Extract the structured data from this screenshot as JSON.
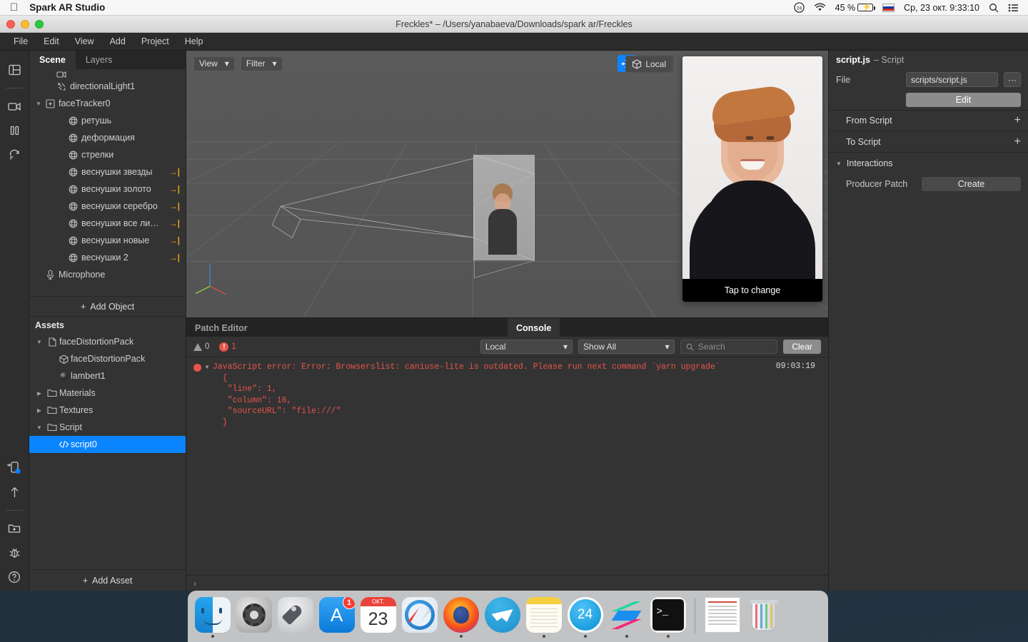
{
  "menubar": {
    "apple_icon": "apple-logo",
    "app_name": "Spark AR Studio",
    "battery_percent": "45 %",
    "datetime": "Ср, 23 окт.  9:33:10",
    "search_icon": "search-icon",
    "list_icon": "control-center-icon",
    "wifi_icon": "wifi-icon",
    "clock24_icon": "24-icon"
  },
  "window": {
    "title": "Freckles* – /Users/yanabaeva/Downloads/spark ar/Freckles",
    "menu": [
      "File",
      "Edit",
      "View",
      "Add",
      "Project",
      "Help"
    ]
  },
  "rail": {
    "items": [
      {
        "name": "layout-icon"
      },
      {
        "name": "camera-icon"
      },
      {
        "name": "pause-icon"
      },
      {
        "name": "refresh-icon"
      }
    ],
    "bottom_items": [
      {
        "name": "send-to-device-icon"
      },
      {
        "name": "upload-icon"
      },
      {
        "name": "new-folder-icon"
      },
      {
        "name": "bug-icon"
      },
      {
        "name": "help-icon"
      }
    ]
  },
  "scene": {
    "tabs": [
      {
        "label": "Scene",
        "active": true
      },
      {
        "label": "Layers",
        "active": false
      }
    ],
    "items": [
      {
        "label": "",
        "icon": "camera-icon",
        "depth": 2,
        "clipped": true,
        "twisty": "",
        "arrow": false
      },
      {
        "label": "directionalLight1",
        "icon": "light-icon",
        "depth": 2,
        "twisty": "",
        "arrow": false
      },
      {
        "label": "faceTracker0",
        "icon": "tracker-icon",
        "depth": 1,
        "twisty": "▼",
        "arrow": false
      },
      {
        "label": "ретушь",
        "icon": "mesh-icon",
        "depth": 3,
        "twisty": "",
        "arrow": false
      },
      {
        "label": "деформация",
        "icon": "mesh-icon",
        "depth": 3,
        "twisty": "",
        "arrow": false
      },
      {
        "label": "стрелки",
        "icon": "mesh-icon",
        "depth": 3,
        "twisty": "",
        "arrow": false
      },
      {
        "label": "веснушки звезды",
        "icon": "mesh-icon",
        "depth": 3,
        "twisty": "",
        "arrow": true
      },
      {
        "label": "веснушки золото",
        "icon": "mesh-icon",
        "depth": 3,
        "twisty": "",
        "arrow": true
      },
      {
        "label": "веснушки серебро",
        "icon": "mesh-icon",
        "depth": 3,
        "twisty": "",
        "arrow": true
      },
      {
        "label": "веснушки все ли…",
        "icon": "mesh-icon",
        "depth": 3,
        "twisty": "",
        "arrow": true
      },
      {
        "label": "веснушки новые",
        "icon": "mesh-icon",
        "depth": 3,
        "twisty": "",
        "arrow": true
      },
      {
        "label": "веснушки 2",
        "icon": "mesh-icon",
        "depth": 3,
        "twisty": "",
        "arrow": true
      },
      {
        "label": "Microphone",
        "icon": "microphone-icon",
        "depth": 1,
        "twisty": "",
        "arrow": false
      }
    ],
    "add_object_label": "Add Object"
  },
  "assets": {
    "header": "Assets",
    "items": [
      {
        "label": "faceDistortionPack",
        "icon": "file-icon",
        "depth": 1,
        "twisty": "▼",
        "selected": false
      },
      {
        "label": "faceDistortionPack",
        "icon": "cube-icon",
        "depth": 2,
        "twisty": "",
        "selected": false
      },
      {
        "label": "lambert1",
        "icon": "sphere-icon",
        "depth": 2,
        "twisty": "",
        "selected": false
      },
      {
        "label": "Materials",
        "icon": "folder-icon",
        "depth": 1,
        "twisty": "▶",
        "selected": false
      },
      {
        "label": "Textures",
        "icon": "folder-icon",
        "depth": 1,
        "twisty": "▶",
        "selected": false
      },
      {
        "label": "Script",
        "icon": "folder-icon",
        "depth": 1,
        "twisty": "▼",
        "selected": false
      },
      {
        "label": "script0",
        "icon": "code-icon",
        "depth": 2,
        "twisty": "",
        "selected": true
      }
    ],
    "add_asset_label": "Add Asset"
  },
  "viewport": {
    "view_dropdown": "View",
    "filter_dropdown": "Filter",
    "tools": [
      {
        "name": "move-tool",
        "active": true
      },
      {
        "name": "rotate-tool",
        "active": false
      },
      {
        "name": "scale-tool",
        "active": false
      }
    ],
    "local_label": "Local",
    "preview_caption": "Tap to change"
  },
  "bottom": {
    "tabs": [
      {
        "label": "Patch Editor",
        "active": false
      },
      {
        "label": "Console",
        "active": true
      }
    ],
    "warning_count": "0",
    "error_count": "1",
    "scope_select": "Local",
    "filter_select": "Show All",
    "search_placeholder": "Search",
    "clear_label": "Clear",
    "log": {
      "message": "JavaScript error: Error: Browserslist: caniuse-lite is outdated. Please run next command `yarn upgrade`",
      "details": "  {\n   \"line\": 1,\n   \"column\": 16,\n   \"sourceURL\": \"file:///\"\n  }",
      "time": "09:03:19"
    },
    "prompt": "›"
  },
  "inspector": {
    "title_bold": "script.js",
    "title_sub": "– Script",
    "file_label": "File",
    "file_value": "scripts/script.js",
    "ellipsis_label": "···",
    "edit_label": "Edit",
    "from_script_label": "From Script",
    "to_script_label": "To Script",
    "interactions_label": "Interactions",
    "producer_patch_label": "Producer Patch",
    "create_label": "Create"
  },
  "dock": {
    "items": [
      {
        "name": "finder",
        "running": true,
        "badge": ""
      },
      {
        "name": "system-preferences",
        "running": false,
        "badge": ""
      },
      {
        "name": "launchpad",
        "running": false,
        "badge": ""
      },
      {
        "name": "app-store",
        "running": false,
        "badge": "1"
      },
      {
        "name": "calendar",
        "running": false,
        "badge": "",
        "month": "ОКТ.",
        "day": "23"
      },
      {
        "name": "safari",
        "running": false,
        "badge": ""
      },
      {
        "name": "firefox",
        "running": true,
        "badge": ""
      },
      {
        "name": "telegram",
        "running": false,
        "badge": ""
      },
      {
        "name": "notes",
        "running": true,
        "badge": ""
      },
      {
        "name": "mail-ru-cloud",
        "running": true,
        "badge": "",
        "label": "24"
      },
      {
        "name": "spark-ar-studio",
        "running": true,
        "badge": ""
      },
      {
        "name": "terminal",
        "running": true,
        "badge": ""
      }
    ],
    "right_items": [
      {
        "name": "document-stack"
      },
      {
        "name": "trash"
      }
    ]
  },
  "colors": {
    "accent": "#0a84ff",
    "error": "#e8544a",
    "arrow": "#e8a317",
    "panel": "#333333"
  }
}
